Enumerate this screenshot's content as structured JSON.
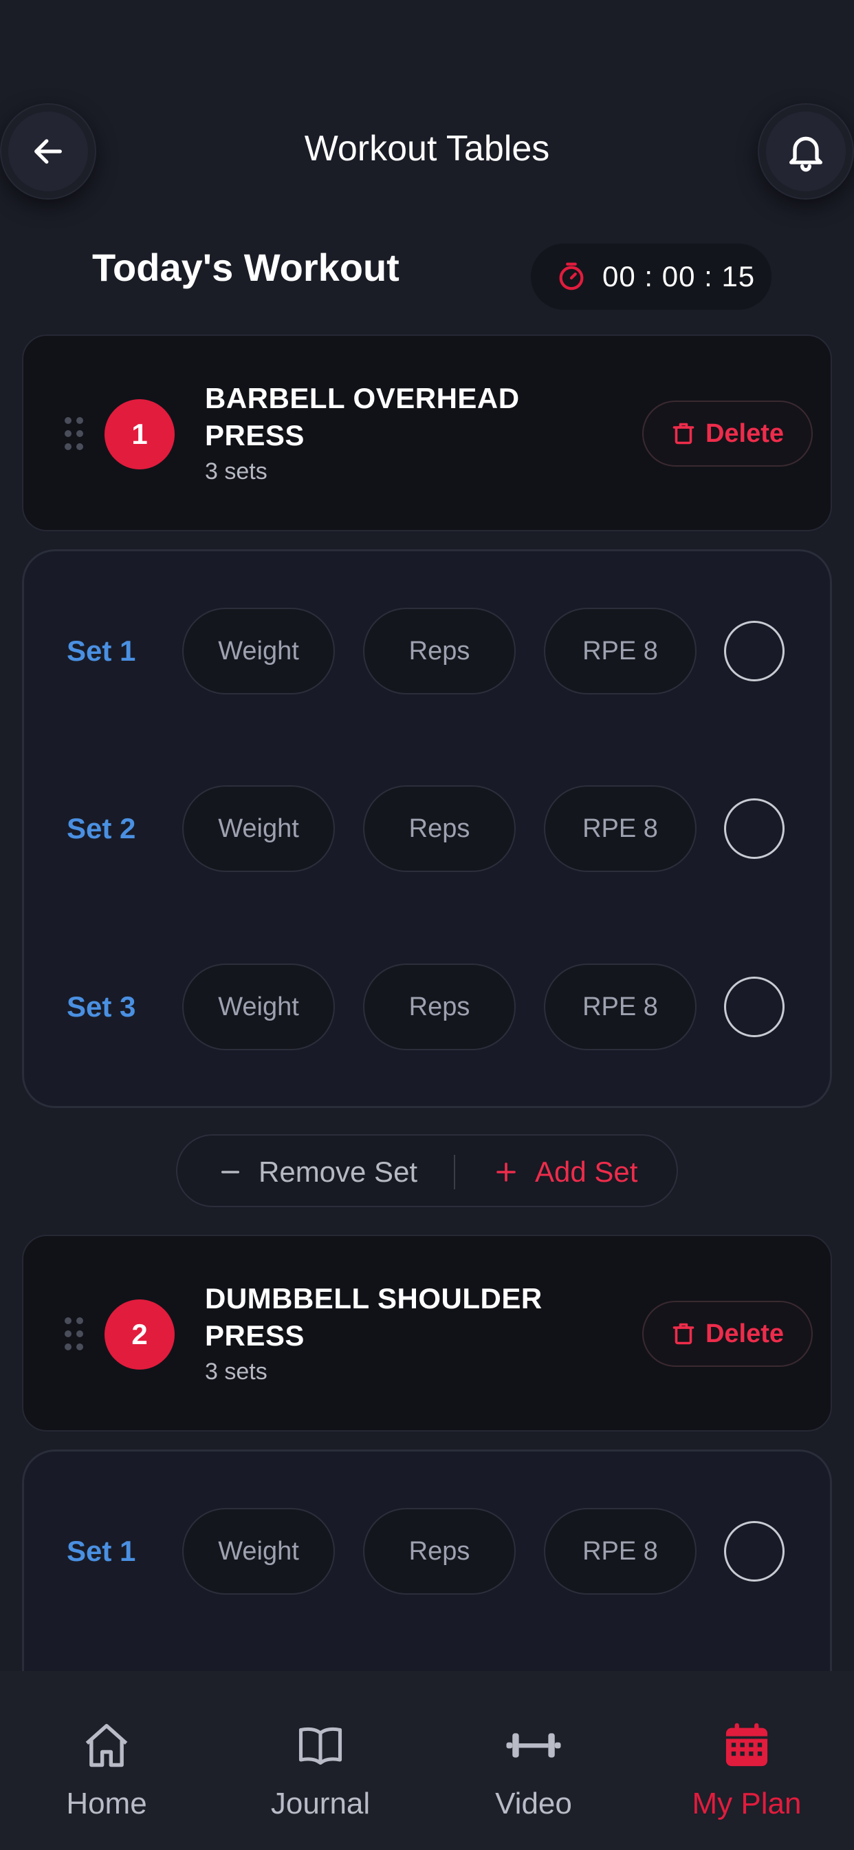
{
  "header": {
    "title": "Workout Tables",
    "back_icon": "arrow-left-icon",
    "bell_icon": "bell-icon"
  },
  "section": {
    "title": "Today's Workout",
    "timer": "00 : 00 : 15",
    "timer_icon": "stopwatch-icon"
  },
  "exercises": [
    {
      "number": "1",
      "name": "BARBELL OVERHEAD PRESS",
      "sets_label": "3 sets",
      "delete_label": "Delete",
      "sets": [
        {
          "label": "Set 1",
          "weight": "Weight",
          "reps": "Reps",
          "rpe": "RPE 8"
        },
        {
          "label": "Set 2",
          "weight": "Weight",
          "reps": "Reps",
          "rpe": "RPE 8"
        },
        {
          "label": "Set 3",
          "weight": "Weight",
          "reps": "Reps",
          "rpe": "RPE 8"
        }
      ]
    },
    {
      "number": "2",
      "name": "DUMBBELL SHOULDER PRESS",
      "sets_label": "3 sets",
      "delete_label": "Delete",
      "sets": [
        {
          "label": "Set 1",
          "weight": "Weight",
          "reps": "Reps",
          "rpe": "RPE 8"
        }
      ]
    }
  ],
  "set_controls": {
    "remove_label": "Remove Set",
    "add_label": "Add Set"
  },
  "nav": {
    "items": [
      {
        "label": "Home",
        "icon": "home-icon"
      },
      {
        "label": "Journal",
        "icon": "book-icon"
      },
      {
        "label": "Video",
        "icon": "dumbbell-icon"
      },
      {
        "label": "My Plan",
        "icon": "calendar-icon",
        "active": true
      }
    ]
  },
  "colors": {
    "background": "#1a1c26",
    "accent_red": "#e21c3d",
    "set_blue": "#4a90e2"
  }
}
